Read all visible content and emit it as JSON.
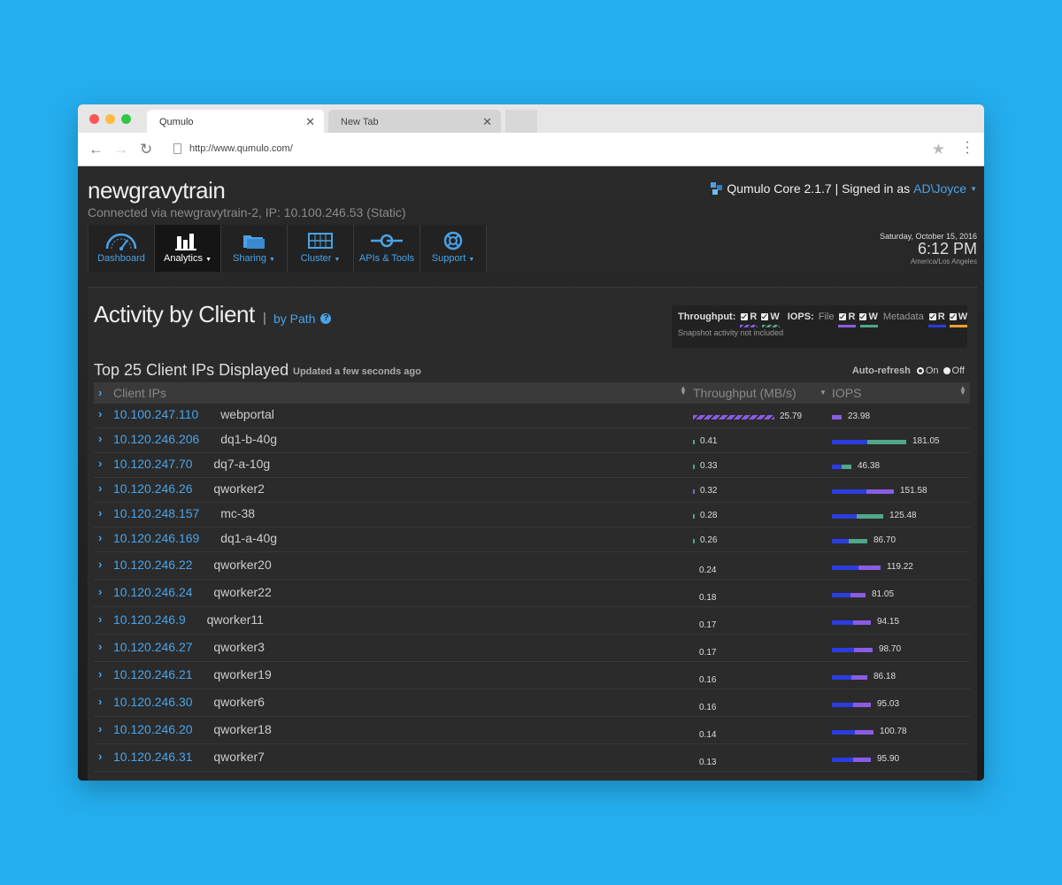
{
  "browser": {
    "tabs": [
      {
        "title": "Qumulo",
        "active": true
      },
      {
        "title": "New Tab",
        "active": false
      }
    ],
    "url": "http://www.qumulo.com/"
  },
  "header": {
    "cluster_name": "newgravytrain",
    "connection": "Connected via newgravytrain-2, IP: 10.100.246.53 (Static)",
    "product": "Qumulo Core 2.1.7",
    "signed_in_text": "| Signed in as",
    "user": "AD\\Joyce"
  },
  "nav": [
    {
      "label": "Dashboard",
      "icon": "gauge-icon",
      "active": false,
      "dropdown": false
    },
    {
      "label": "Analytics",
      "icon": "bar-chart-icon",
      "active": true,
      "dropdown": true
    },
    {
      "label": "Sharing",
      "icon": "folder-share-icon",
      "active": false,
      "dropdown": true
    },
    {
      "label": "Cluster",
      "icon": "server-grid-icon",
      "active": false,
      "dropdown": true
    },
    {
      "label": "APIs & Tools",
      "icon": "api-connector-icon",
      "active": false,
      "dropdown": false
    },
    {
      "label": "Support",
      "icon": "lifebuoy-icon",
      "active": false,
      "dropdown": true
    }
  ],
  "datetime": {
    "date": "Saturday, October 15, 2016",
    "time": "6:12 PM",
    "timezone": "America/Los Angeles"
  },
  "page": {
    "title": "Activity by Client",
    "separator": "|",
    "alt_view": "by Path",
    "subtitle": "Top 25 Client IPs Displayed",
    "updated": "Updated a few seconds ago"
  },
  "legend": {
    "throughput_label": "Throughput:",
    "iops_label": "IOPS:",
    "file_label": "File",
    "metadata_label": "Metadata",
    "read": "R",
    "write": "W",
    "note": "Snapshot activity not included",
    "colors": {
      "throughput_read": "#8a5ce6",
      "throughput_write": "#4fa88a",
      "file_read": "#8a5ce6",
      "file_write": "#4fa88a",
      "metadata_read": "#2b3ce0",
      "metadata_write": "#f0a030"
    }
  },
  "autorefresh": {
    "label": "Auto-refresh",
    "on": "On",
    "off": "Off",
    "selected": "On"
  },
  "table": {
    "columns": [
      "Client IPs",
      "Throughput (MB/s)",
      "IOPS"
    ],
    "rows": [
      {
        "ip": "10.100.247.110",
        "host": "webportal",
        "throughput": "25.79",
        "iops": "23.98"
      },
      {
        "ip": "10.120.246.206",
        "host": "dq1-b-40g",
        "throughput": "0.41",
        "iops": "181.05"
      },
      {
        "ip": "10.120.247.70",
        "host": "dq7-a-10g",
        "throughput": "0.33",
        "iops": "46.38"
      },
      {
        "ip": "10.120.246.26",
        "host": "qworker2",
        "throughput": "0.32",
        "iops": "151.58"
      },
      {
        "ip": "10.120.248.157",
        "host": "mc-38",
        "throughput": "0.28",
        "iops": "125.48"
      },
      {
        "ip": "10.120.246.169",
        "host": "dq1-a-40g",
        "throughput": "0.26",
        "iops": "86.70"
      },
      {
        "ip": "10.120.246.22",
        "host": "qworker20",
        "throughput": "0.24",
        "iops": "119.22"
      },
      {
        "ip": "10.120.246.24",
        "host": "qworker22",
        "throughput": "0.18",
        "iops": "81.05"
      },
      {
        "ip": "10.120.246.9",
        "host": "qworker11",
        "throughput": "0.17",
        "iops": "94.15"
      },
      {
        "ip": "10.120.246.27",
        "host": "qworker3",
        "throughput": "0.17",
        "iops": "98.70"
      },
      {
        "ip": "10.120.246.21",
        "host": "qworker19",
        "throughput": "0.16",
        "iops": "86.18"
      },
      {
        "ip": "10.120.246.30",
        "host": "qworker6",
        "throughput": "0.16",
        "iops": "95.03"
      },
      {
        "ip": "10.120.246.20",
        "host": "qworker18",
        "throughput": "0.14",
        "iops": "100.78"
      },
      {
        "ip": "10.120.246.31",
        "host": "qworker7",
        "throughput": "0.13",
        "iops": "95.90"
      }
    ]
  }
}
